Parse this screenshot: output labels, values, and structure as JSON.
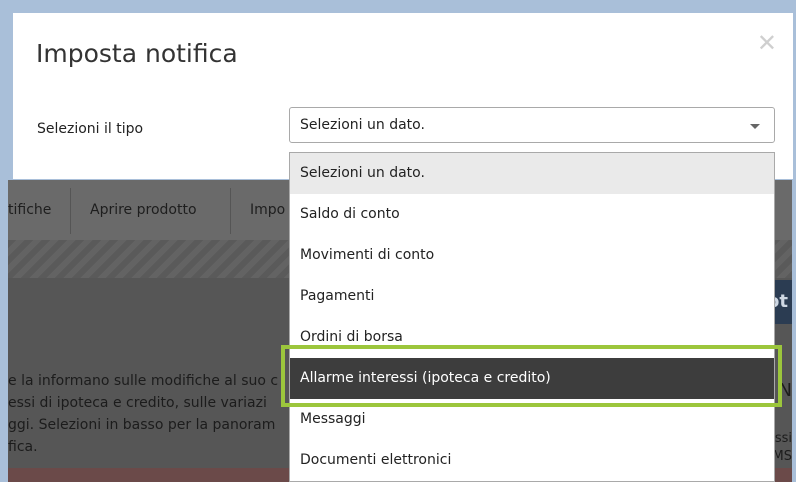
{
  "modal": {
    "title": "Imposta notifica",
    "close_icon": "close-icon",
    "field_label": "Selezioni il tipo",
    "select_value": "Selezioni un dato."
  },
  "dropdown": {
    "items": [
      {
        "label": "Selezioni un dato."
      },
      {
        "label": "Saldo di conto"
      },
      {
        "label": "Movimenti di conto"
      },
      {
        "label": "Pagamenti"
      },
      {
        "label": "Ordini di borsa"
      },
      {
        "label": "Allarme interessi (ipoteca e credito)"
      },
      {
        "label": "Messaggi"
      },
      {
        "label": "Documenti elettronici"
      }
    ],
    "highlighted_index": 5,
    "highlight_color": "#9cc63c"
  },
  "background": {
    "tabs": [
      "tifiche",
      "Aprire prodotto",
      "Impo"
    ],
    "blue_label": "ot",
    "body_lines": [
      "e la informano sulle modifiche al suo c",
      "essi di ipoteca e credito, sulle variazi",
      "ggi. Selezioni in basso per la panoram",
      "fica."
    ],
    "right_letter": "N",
    "right_lines": [
      "ssi",
      "MS"
    ]
  }
}
